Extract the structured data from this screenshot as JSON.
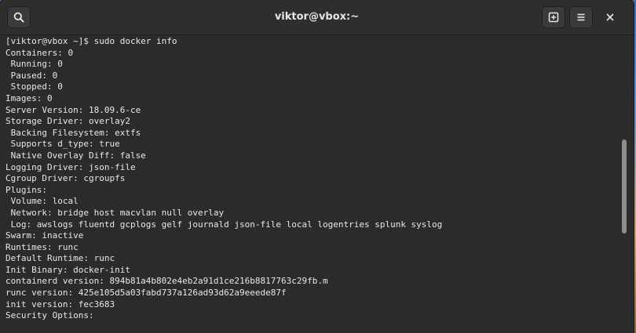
{
  "window": {
    "title": "viktor@vbox:~"
  },
  "titlebar": {
    "search_icon": "search-icon",
    "new_tab_icon": "new-tab-icon",
    "menu_icon": "hamburger-menu-icon",
    "close_icon": "close-icon"
  },
  "terminal": {
    "lines": [
      "[viktor@vbox ~]$ sudo docker info",
      "Containers: 0",
      " Running: 0",
      " Paused: 0",
      " Stopped: 0",
      "Images: 0",
      "Server Version: 18.09.6-ce",
      "Storage Driver: overlay2",
      " Backing Filesystem: extfs",
      " Supports d_type: true",
      " Native Overlay Diff: false",
      "Logging Driver: json-file",
      "Cgroup Driver: cgroupfs",
      "Plugins:",
      " Volume: local",
      " Network: bridge host macvlan null overlay",
      " Log: awslogs fluentd gcplogs gelf journald json-file local logentries splunk syslog",
      "Swarm: inactive",
      "Runtimes: runc",
      "Default Runtime: runc",
      "Init Binary: docker-init",
      "containerd version: 894b81a4b802e4eb2a91d1ce216b8817763c29fb.m",
      "runc version: 425e105d5a03fabd737a126ad93d62a9eeede87f",
      "init version: fec3683",
      "Security Options:"
    ]
  },
  "colors": {
    "terminal_bg": "#2b2b2b",
    "terminal_fg": "#e8e8e8",
    "titlebar_bg": "#2e2e2e"
  }
}
